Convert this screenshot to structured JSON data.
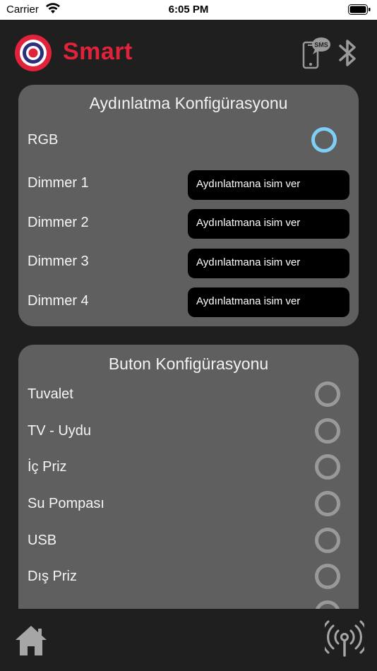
{
  "status_bar": {
    "carrier": "Carrier",
    "time": "6:05 PM",
    "wifi_icon": "wifi-icon",
    "battery_icon": "battery-icon"
  },
  "header": {
    "brand": "Smart",
    "brand_color": "#e0233a",
    "logo_icon": "target-logo",
    "sms_icon": "phone-sms-icon",
    "sms_text": "SMS",
    "bluetooth_icon": "bluetooth-icon"
  },
  "lighting": {
    "title": "Aydınlatma Konfigürasyonu",
    "rgb_label": "RGB",
    "rgb_selected": true,
    "dimmers": [
      {
        "label": "Dimmer 1",
        "placeholder": "Aydınlatmana isim ver"
      },
      {
        "label": "Dimmer 2",
        "placeholder": "Aydınlatmana isim ver"
      },
      {
        "label": "Dimmer 3",
        "placeholder": "Aydınlatmana isim ver"
      },
      {
        "label": "Dimmer 4",
        "placeholder": "Aydınlatmana isim ver"
      }
    ]
  },
  "buttons": {
    "title": "Buton Konfigürasyonu",
    "items": [
      {
        "label": "Tuvalet",
        "selected": false
      },
      {
        "label": "TV - Uydu",
        "selected": false
      },
      {
        "label": "İç Priz",
        "selected": false
      },
      {
        "label": "Su Pompası",
        "selected": false
      },
      {
        "label": "USB",
        "selected": false
      },
      {
        "label": "Dış Priz",
        "selected": false
      }
    ]
  },
  "colors": {
    "background": "#1f1f1f",
    "card": "#5f5f5f",
    "radio_active": "#7fcef6",
    "radio_inactive": "#999999"
  },
  "bottom_bar": {
    "home_icon": "home-icon",
    "broadcast_icon": "broadcast-icon"
  }
}
